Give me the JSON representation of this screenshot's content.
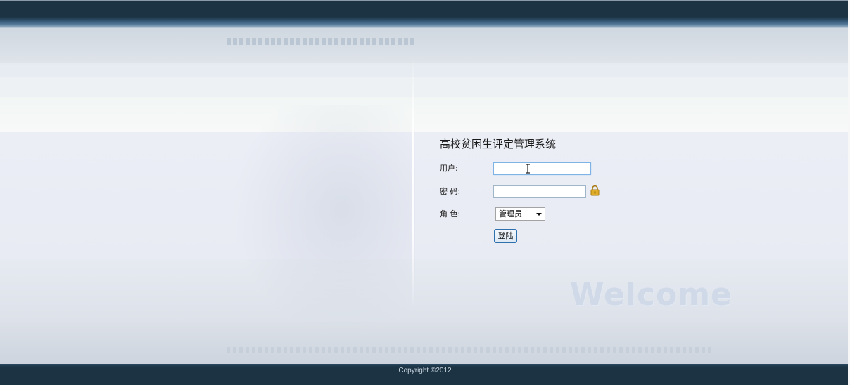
{
  "app": {
    "title": "高校贫困生评定管理系统",
    "welcome_text": "Welcome",
    "copyright": "Copyright ©2012"
  },
  "form": {
    "user_label": "用户:",
    "user_value": "",
    "password_label": "密 码:",
    "password_value": "",
    "role_label": "角 色:",
    "role_selected": "管理员",
    "login_button": "登陆"
  },
  "icons": {
    "password_icon": "lock-icon",
    "select_icon": "chevron-down-icon",
    "cursor_icon": "text-cursor-icon"
  },
  "colors": {
    "header_bar": "#1c3344",
    "footer_bar": "#1c3344",
    "lock_gold": "#d9a520",
    "focus_border": "#7fb3e6"
  }
}
